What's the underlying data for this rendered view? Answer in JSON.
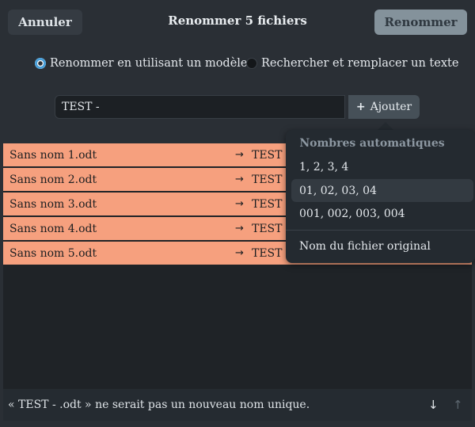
{
  "header": {
    "cancel_label": "Annuler",
    "title": "Renommer 5 fichiers",
    "rename_label": "Renommer"
  },
  "mode": {
    "template_label": "Renommer en utilisant un modèle",
    "template_selected": true,
    "replace_label": "Rechercher et remplacer un texte",
    "replace_selected": false
  },
  "template": {
    "value": "TEST -",
    "add_label": "Ajouter"
  },
  "files": [
    {
      "old": "Sans nom 1.odt",
      "new": "TEST -"
    },
    {
      "old": "Sans nom 2.odt",
      "new": "TEST -"
    },
    {
      "old": "Sans nom 3.odt",
      "new": "TEST -"
    },
    {
      "old": "Sans nom 4.odt",
      "new": "TEST -"
    },
    {
      "old": "Sans nom 5.odt",
      "new": "TEST -"
    }
  ],
  "popover": {
    "title": "Nombres automatiques",
    "items": [
      "1, 2, 3, 4",
      "01, 02, 03, 04",
      "001, 002, 003, 004"
    ],
    "highlighted": "01, 02, 03, 04",
    "original_name_label": "Nom du fichier original"
  },
  "status": {
    "message": "« TEST - .odt » ne serait pas un nouveau nom unique."
  },
  "colors": {
    "conflict_row": "#f6a07e",
    "background": "#2a2f35"
  },
  "icons": {
    "arrow": "→",
    "add": "+",
    "next_conflict": "↓",
    "previous_conflict": "↑"
  }
}
